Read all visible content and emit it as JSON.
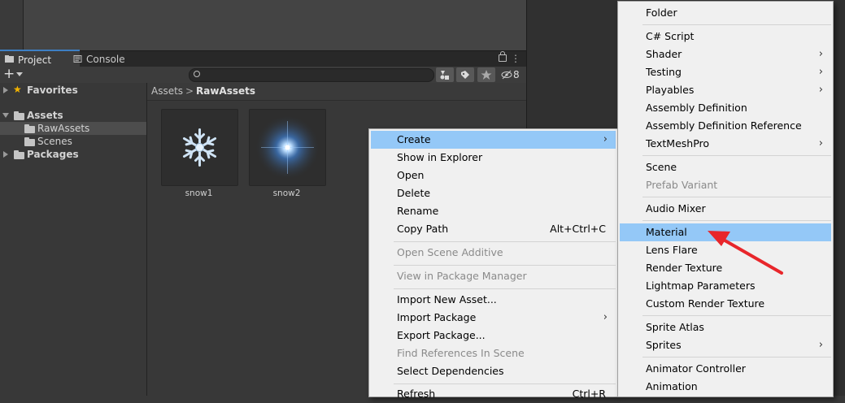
{
  "tabs": {
    "project": "Project",
    "console": "Console",
    "hidden_count": "8"
  },
  "toolbar": {
    "plus": "+"
  },
  "tree": {
    "favorites": "Favorites",
    "assets": "Assets",
    "rawassets": "RawAssets",
    "scenes": "Scenes",
    "packages": "Packages"
  },
  "breadcrumb": {
    "root": "Assets",
    "sep": ">",
    "current": "RawAssets"
  },
  "assets": [
    {
      "label": "snow1"
    },
    {
      "label": "snow2"
    }
  ],
  "context_menu": {
    "items": [
      {
        "label": "Create",
        "submenu": true,
        "selected": true
      },
      {
        "label": "Show in Explorer"
      },
      {
        "label": "Open"
      },
      {
        "label": "Delete"
      },
      {
        "label": "Rename"
      },
      {
        "label": "Copy Path",
        "shortcut": "Alt+Ctrl+C"
      },
      {
        "label": "Open Scene Additive",
        "disabled": true
      },
      {
        "label": "View in Package Manager",
        "disabled": true
      },
      {
        "label": "Import New Asset..."
      },
      {
        "label": "Import Package",
        "submenu": true
      },
      {
        "label": "Export Package..."
      },
      {
        "label": "Find References In Scene",
        "disabled": true
      },
      {
        "label": "Select Dependencies"
      },
      {
        "label": "Refresh",
        "shortcut": "Ctrl+R"
      }
    ]
  },
  "create_menu": {
    "items": [
      {
        "label": "Folder"
      },
      {
        "label": "C# Script"
      },
      {
        "label": "Shader",
        "submenu": true
      },
      {
        "label": "Testing",
        "submenu": true
      },
      {
        "label": "Playables",
        "submenu": true
      },
      {
        "label": "Assembly Definition"
      },
      {
        "label": "Assembly Definition Reference"
      },
      {
        "label": "TextMeshPro",
        "submenu": true
      },
      {
        "label": "Scene"
      },
      {
        "label": "Prefab Variant",
        "disabled": true
      },
      {
        "label": "Audio Mixer"
      },
      {
        "label": "Material",
        "selected": true
      },
      {
        "label": "Lens Flare"
      },
      {
        "label": "Render Texture"
      },
      {
        "label": "Lightmap Parameters"
      },
      {
        "label": "Custom Render Texture"
      },
      {
        "label": "Sprite Atlas"
      },
      {
        "label": "Sprites",
        "submenu": true
      },
      {
        "label": "Animator Controller"
      },
      {
        "label": "Animation"
      }
    ]
  },
  "colors": {
    "highlight": "#94c8f7",
    "arrow": "#e8262b",
    "accent": "#3d7fc4"
  }
}
